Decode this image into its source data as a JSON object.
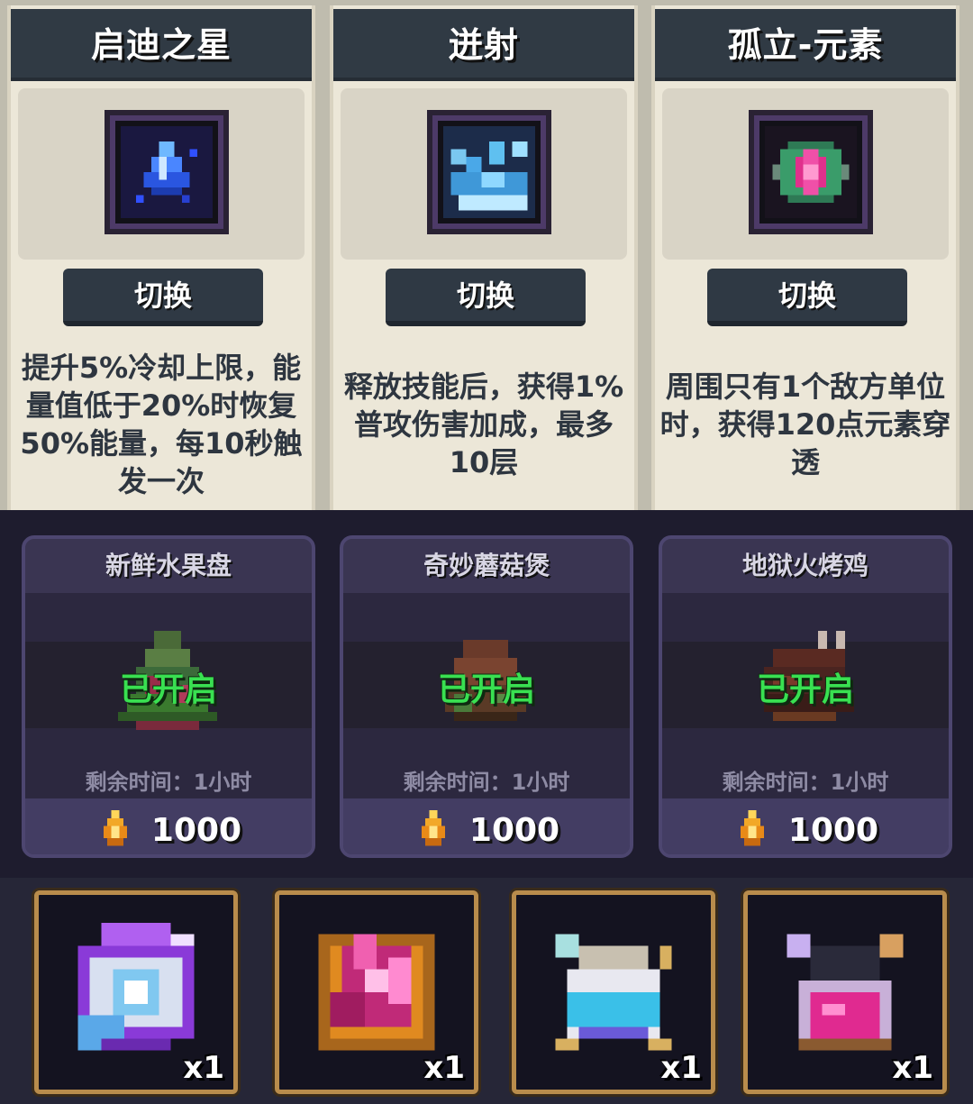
{
  "talents": [
    {
      "title": "启迪之星",
      "button": "切换",
      "desc": "提升5%冷却上限，能量值低于20%时恢复50%能量，每10秒触发一次"
    },
    {
      "title": "迸射",
      "button": "切换",
      "desc": "释放技能后，获得1%普攻伤害加成，最多10层"
    },
    {
      "title": "孤立-元素",
      "button": "切换",
      "desc": "周围只有1个敌方单位时，获得120点元素穿透"
    }
  ],
  "foods": [
    {
      "name": "新鲜水果盘",
      "status": "已开启",
      "time": "剩余时间：1小时",
      "price": "1000"
    },
    {
      "name": "奇妙蘑菇煲",
      "status": "已开启",
      "time": "剩余时间：1小时",
      "price": "1000"
    },
    {
      "name": "地狱火烤鸡",
      "status": "已开启",
      "time": "剩余时间：1小时",
      "price": "1000"
    }
  ],
  "items": [
    {
      "icon": "purple-orb-icon",
      "qty": "x1"
    },
    {
      "icon": "pink-crystal-icon",
      "qty": "x1"
    },
    {
      "icon": "blue-potion-icon",
      "qty": "x1"
    },
    {
      "icon": "pink-potion-icon",
      "qty": "x1"
    }
  ],
  "colors": {
    "status_green": "#39e051",
    "slot_border": "#b98c4c",
    "title_bar": "#303a44"
  }
}
